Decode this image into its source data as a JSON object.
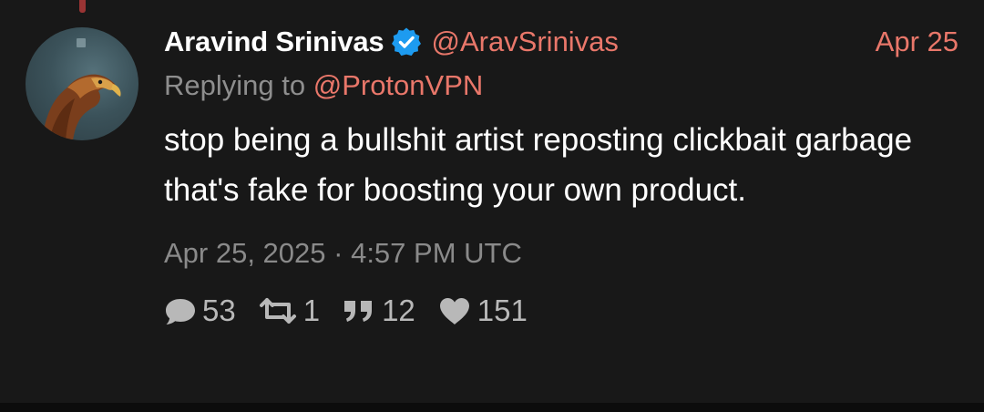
{
  "tweet": {
    "author": {
      "display_name": "Aravind Srinivas",
      "handle": "@AravSrinivas",
      "verified": true
    },
    "date_short": "Apr 25",
    "replying_to_label": "Replying to",
    "replying_to_handle": "@ProtonVPN",
    "text": "stop being a bullshit artist reposting clickbait garbage that's fake for boosting your own product.",
    "timestamp": "Apr 25, 2025 · 4:57 PM UTC",
    "stats": {
      "replies": "53",
      "retweets": "1",
      "quotes": "12",
      "likes": "151"
    }
  },
  "icons": {
    "verified": "verified-badge-icon",
    "reply": "comment-icon",
    "retweet": "retweet-icon",
    "quote": "quote-icon",
    "like": "heart-icon"
  },
  "colors": {
    "background": "#181818",
    "accent": "#e9776a",
    "muted": "#8e8e8e",
    "verified": "#1d9bf0"
  }
}
